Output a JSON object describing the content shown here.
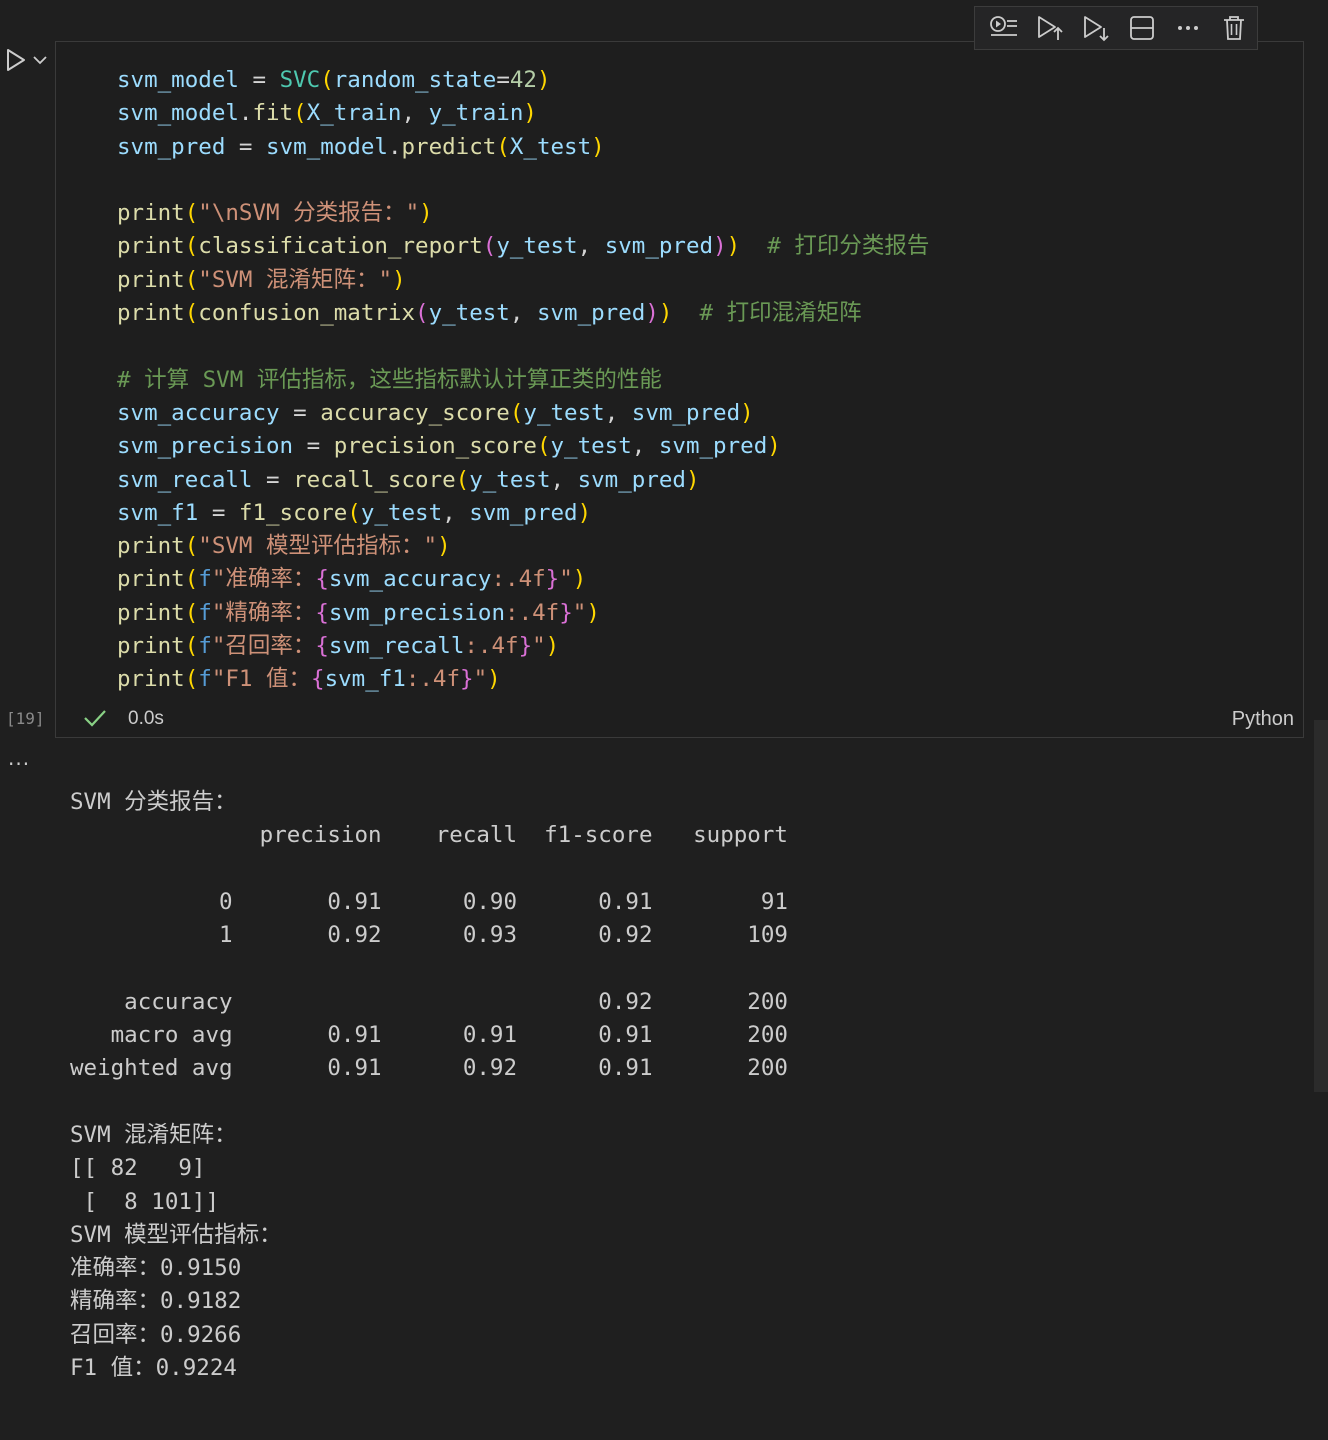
{
  "cell": {
    "execution_count": "[19]",
    "status_time": "0.0s",
    "language": "Python",
    "code_lines": [
      [
        {
          "t": "svm_model",
          "c": "var"
        },
        {
          "t": " = ",
          "c": "op"
        },
        {
          "t": "SVC",
          "c": "cls"
        },
        {
          "t": "(",
          "c": "p1"
        },
        {
          "t": "random_state",
          "c": "var"
        },
        {
          "t": "=",
          "c": "op"
        },
        {
          "t": "42",
          "c": "num"
        },
        {
          "t": ")",
          "c": "p1"
        }
      ],
      [
        {
          "t": "svm_model",
          "c": "var"
        },
        {
          "t": ".",
          "c": "op"
        },
        {
          "t": "fit",
          "c": "fn"
        },
        {
          "t": "(",
          "c": "p1"
        },
        {
          "t": "X_train",
          "c": "var"
        },
        {
          "t": ", ",
          "c": "op"
        },
        {
          "t": "y_train",
          "c": "var"
        },
        {
          "t": ")",
          "c": "p1"
        }
      ],
      [
        {
          "t": "svm_pred",
          "c": "var"
        },
        {
          "t": " = ",
          "c": "op"
        },
        {
          "t": "svm_model",
          "c": "var"
        },
        {
          "t": ".",
          "c": "op"
        },
        {
          "t": "predict",
          "c": "fn"
        },
        {
          "t": "(",
          "c": "p1"
        },
        {
          "t": "X_test",
          "c": "var"
        },
        {
          "t": ")",
          "c": "p1"
        }
      ],
      [],
      [
        {
          "t": "print",
          "c": "fn"
        },
        {
          "t": "(",
          "c": "p1"
        },
        {
          "t": "\"\\nSVM 分类报告：\"",
          "c": "str"
        },
        {
          "t": ")",
          "c": "p1"
        }
      ],
      [
        {
          "t": "print",
          "c": "fn"
        },
        {
          "t": "(",
          "c": "p1"
        },
        {
          "t": "classification_report",
          "c": "fn"
        },
        {
          "t": "(",
          "c": "p2"
        },
        {
          "t": "y_test",
          "c": "var"
        },
        {
          "t": ", ",
          "c": "op"
        },
        {
          "t": "svm_pred",
          "c": "var"
        },
        {
          "t": ")",
          "c": "p2"
        },
        {
          "t": ")",
          "c": "p1"
        },
        {
          "t": "  # 打印分类报告",
          "c": "cmt"
        }
      ],
      [
        {
          "t": "print",
          "c": "fn"
        },
        {
          "t": "(",
          "c": "p1"
        },
        {
          "t": "\"SVM 混淆矩阵：\"",
          "c": "str"
        },
        {
          "t": ")",
          "c": "p1"
        }
      ],
      [
        {
          "t": "print",
          "c": "fn"
        },
        {
          "t": "(",
          "c": "p1"
        },
        {
          "t": "confusion_matrix",
          "c": "fn"
        },
        {
          "t": "(",
          "c": "p2"
        },
        {
          "t": "y_test",
          "c": "var"
        },
        {
          "t": ", ",
          "c": "op"
        },
        {
          "t": "svm_pred",
          "c": "var"
        },
        {
          "t": ")",
          "c": "p2"
        },
        {
          "t": ")",
          "c": "p1"
        },
        {
          "t": "  # 打印混淆矩阵",
          "c": "cmt"
        }
      ],
      [],
      [
        {
          "t": "# 计算 SVM 评估指标，这些指标默认计算正类的性能",
          "c": "cmt"
        }
      ],
      [
        {
          "t": "svm_accuracy",
          "c": "var"
        },
        {
          "t": " = ",
          "c": "op"
        },
        {
          "t": "accuracy_score",
          "c": "fn"
        },
        {
          "t": "(",
          "c": "p1"
        },
        {
          "t": "y_test",
          "c": "var"
        },
        {
          "t": ", ",
          "c": "op"
        },
        {
          "t": "svm_pred",
          "c": "var"
        },
        {
          "t": ")",
          "c": "p1"
        }
      ],
      [
        {
          "t": "svm_precision",
          "c": "var"
        },
        {
          "t": " = ",
          "c": "op"
        },
        {
          "t": "precision_score",
          "c": "fn"
        },
        {
          "t": "(",
          "c": "p1"
        },
        {
          "t": "y_test",
          "c": "var"
        },
        {
          "t": ", ",
          "c": "op"
        },
        {
          "t": "svm_pred",
          "c": "var"
        },
        {
          "t": ")",
          "c": "p1"
        }
      ],
      [
        {
          "t": "svm_recall",
          "c": "var"
        },
        {
          "t": " = ",
          "c": "op"
        },
        {
          "t": "recall_score",
          "c": "fn"
        },
        {
          "t": "(",
          "c": "p1"
        },
        {
          "t": "y_test",
          "c": "var"
        },
        {
          "t": ", ",
          "c": "op"
        },
        {
          "t": "svm_pred",
          "c": "var"
        },
        {
          "t": ")",
          "c": "p1"
        }
      ],
      [
        {
          "t": "svm_f1",
          "c": "var"
        },
        {
          "t": " = ",
          "c": "op"
        },
        {
          "t": "f1_score",
          "c": "fn"
        },
        {
          "t": "(",
          "c": "p1"
        },
        {
          "t": "y_test",
          "c": "var"
        },
        {
          "t": ", ",
          "c": "op"
        },
        {
          "t": "svm_pred",
          "c": "var"
        },
        {
          "t": ")",
          "c": "p1"
        }
      ],
      [
        {
          "t": "print",
          "c": "fn"
        },
        {
          "t": "(",
          "c": "p1"
        },
        {
          "t": "\"SVM 模型评估指标：\"",
          "c": "str"
        },
        {
          "t": ")",
          "c": "p1"
        }
      ],
      [
        {
          "t": "print",
          "c": "fn"
        },
        {
          "t": "(",
          "c": "p1"
        },
        {
          "t": "f",
          "c": "kw"
        },
        {
          "t": "\"准确率：",
          "c": "str"
        },
        {
          "t": "{",
          "c": "p2"
        },
        {
          "t": "svm_accuracy",
          "c": "var"
        },
        {
          "t": ":.4f",
          "c": "str"
        },
        {
          "t": "}",
          "c": "p2"
        },
        {
          "t": "\"",
          "c": "str"
        },
        {
          "t": ")",
          "c": "p1"
        }
      ],
      [
        {
          "t": "print",
          "c": "fn"
        },
        {
          "t": "(",
          "c": "p1"
        },
        {
          "t": "f",
          "c": "kw"
        },
        {
          "t": "\"精确率：",
          "c": "str"
        },
        {
          "t": "{",
          "c": "p2"
        },
        {
          "t": "svm_precision",
          "c": "var"
        },
        {
          "t": ":.4f",
          "c": "str"
        },
        {
          "t": "}",
          "c": "p2"
        },
        {
          "t": "\"",
          "c": "str"
        },
        {
          "t": ")",
          "c": "p1"
        }
      ],
      [
        {
          "t": "print",
          "c": "fn"
        },
        {
          "t": "(",
          "c": "p1"
        },
        {
          "t": "f",
          "c": "kw"
        },
        {
          "t": "\"召回率：",
          "c": "str"
        },
        {
          "t": "{",
          "c": "p2"
        },
        {
          "t": "svm_recall",
          "c": "var"
        },
        {
          "t": ":.4f",
          "c": "str"
        },
        {
          "t": "}",
          "c": "p2"
        },
        {
          "t": "\"",
          "c": "str"
        },
        {
          "t": ")",
          "c": "p1"
        }
      ],
      [
        {
          "t": "print",
          "c": "fn"
        },
        {
          "t": "(",
          "c": "p1"
        },
        {
          "t": "f",
          "c": "kw"
        },
        {
          "t": "\"F1 值：",
          "c": "str"
        },
        {
          "t": "{",
          "c": "p2"
        },
        {
          "t": "svm_f1",
          "c": "var"
        },
        {
          "t": ":.4f",
          "c": "str"
        },
        {
          "t": "}",
          "c": "p2"
        },
        {
          "t": "\"",
          "c": "str"
        },
        {
          "t": ")",
          "c": "p1"
        }
      ]
    ]
  },
  "toolbar": {
    "items": [
      {
        "name": "execute-above-icon",
        "label": "Execute Above Cells"
      },
      {
        "name": "execute-cell-below-icon",
        "label": "Execute Cell and Below"
      },
      {
        "name": "run-below-icon",
        "label": "Run Below"
      },
      {
        "name": "split-cell-icon",
        "label": "Split Cell"
      },
      {
        "name": "more-actions-icon",
        "label": "More Actions"
      },
      {
        "name": "delete-icon",
        "label": "Delete Cell"
      }
    ]
  },
  "output": {
    "more_label": "···",
    "lines": [
      "SVM 分类报告：",
      "              precision    recall  f1-score   support",
      "",
      "           0       0.91      0.90      0.91        91",
      "           1       0.92      0.93      0.92       109",
      "",
      "    accuracy                           0.92       200",
      "   macro avg       0.91      0.91      0.91       200",
      "weighted avg       0.91      0.92      0.91       200",
      "",
      "SVM 混淆矩阵：",
      "[[ 82   9]",
      " [  8 101]]",
      "SVM 模型评估指标：",
      "准确率：0.9150",
      "精确率：0.9182",
      "召回率：0.9266",
      "F1 值：0.9224"
    ]
  },
  "colors": {
    "background": "#1f1f1f",
    "variable": "#9cdcfe",
    "function": "#dcdcaa",
    "class": "#4ec9b0",
    "number": "#b5cea8",
    "string": "#ce9178",
    "comment": "#6a9955",
    "success": "#89d185"
  }
}
